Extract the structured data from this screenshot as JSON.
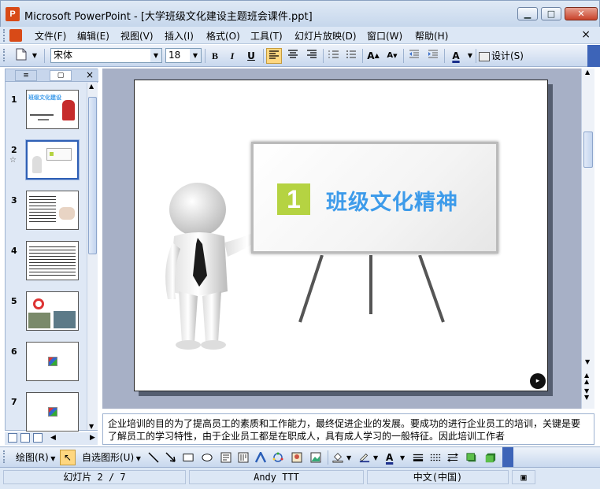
{
  "window": {
    "app_icon": "P",
    "title": "Microsoft PowerPoint - [大学班级文化建设主题班会课件.ppt]",
    "minimize": "▁",
    "maximize": "□",
    "close": "✕"
  },
  "menubar": {
    "items": [
      "文件(F)",
      "编辑(E)",
      "视图(V)",
      "插入(I)",
      "格式(O)",
      "工具(T)",
      "幻灯片放映(D)",
      "窗口(W)",
      "帮助(H)"
    ],
    "close": "×"
  },
  "toolbar": {
    "font_name": "宋体",
    "font_size": "18",
    "bold": "B",
    "italic": "I",
    "underline": "U",
    "design_label": "设计(S)"
  },
  "outline_tabs": {
    "outline": "≡",
    "slides": "▢",
    "close": "×"
  },
  "slides": [
    {
      "number": "1",
      "title": "班级文化建设"
    },
    {
      "number": "2",
      "title": ""
    },
    {
      "number": "3",
      "title": ""
    },
    {
      "number": "4",
      "title": ""
    },
    {
      "number": "5",
      "title": ""
    },
    {
      "number": "6",
      "title": ""
    },
    {
      "number": "7",
      "title": ""
    }
  ],
  "current_slide": {
    "number_badge": "1",
    "title": "班级文化精神"
  },
  "notes": {
    "text": "企业培训的目的为了提高员工的素质和工作能力，最终促进企业的发展。要成功的进行企业员工的培训，关键是要了解员工的学习特性，由于企业员工都是在职成人，具有成人学习的一般特征。因此培训工作者"
  },
  "drawing_toolbar": {
    "draw_label": "绘图(R)",
    "autoshapes_label": "自选图形(U)"
  },
  "status": {
    "slide_info": "幻灯片 2 / 7",
    "template": "Andy TTT",
    "language": "中文(中国)"
  },
  "colors": {
    "accent_blue": "#3d9bea",
    "badge_green": "#b5d342",
    "titlebar": "#c6d7ec"
  }
}
